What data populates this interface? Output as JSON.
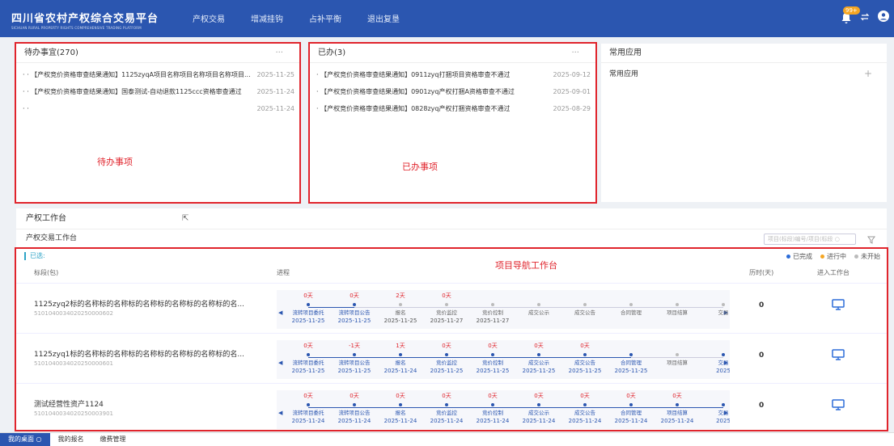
{
  "header": {
    "title": "四川省农村产权综合交易平台",
    "subtitle": "SICHUAN RURAL PROPERTY RIGHTS COMPREHENSIVE TRADING PLATFORM",
    "nav": [
      "产权交易",
      "增减挂钩",
      "占补平衡",
      "退出复垦"
    ],
    "badge": "99+"
  },
  "todo": {
    "title": "待办事宜(270)",
    "more": "···",
    "items": [
      {
        "text": "· · 【产权竞价资格审查结果通知】1125zyqA项目名称项目名称项目名称项目...",
        "date": "2025-11-25"
      },
      {
        "text": "· · 【产权竞价资格审查结果通知】国泰测试-自动退款1125ccc资格审查通过",
        "date": "2025-11-24"
      },
      {
        "text": "· ·",
        "date": "2025-11-24"
      }
    ],
    "annotation": "待办事项"
  },
  "done": {
    "title": "已办(3)",
    "more": "···",
    "items": [
      {
        "text": "· 【产权竞价资格审查结果通知】0911zyq打捆项目资格审查不通过",
        "date": "2025-09-12"
      },
      {
        "text": "· 【产权竞价资格审查结果通知】0901zyq产权打捆A资格审查不通过",
        "date": "2025-09-01"
      },
      {
        "text": "· 【产权竞价资格审查结果通知】0828zyq产权打捆资格审查不通过",
        "date": "2025-08-29"
      }
    ],
    "annotation": "已办事项"
  },
  "common": {
    "title": "常用应用",
    "subtitle": "常用应用",
    "plus": "+"
  },
  "workbench": {
    "title": "产权工作台",
    "subtitle": "产权交易工作台",
    "search_placeholder": "项目(标段)编号/项目(标段 ○",
    "selected": "已选:",
    "annotation": "项目导航工作台",
    "legend": [
      {
        "label": "已完成",
        "color": "#2b6cd8"
      },
      {
        "label": "进行中",
        "color": "#f5a623"
      },
      {
        "label": "未开始",
        "color": "#bbbbbb"
      }
    ],
    "columns": {
      "name": "标段(包)",
      "progress": "进程",
      "duration": "历时(天)",
      "enter": "进入工作台"
    },
    "rows": [
      {
        "name": "1125zyq2标的名称标的名称标的名称标的名称标的名称标的名...",
        "code": "5101040034020250000602",
        "duration": "0",
        "stages": [
          {
            "name": "流转项目委托",
            "days": "0天",
            "date": "2025-11-25",
            "done": true
          },
          {
            "name": "流转项目公告",
            "days": "0天",
            "date": "2025-11-25",
            "done": true
          },
          {
            "name": "报名",
            "days": "2天",
            "date": "2025-11-25",
            "done": false
          },
          {
            "name": "竞价监控",
            "days": "0天",
            "date": "2025-11-27",
            "done": false
          },
          {
            "name": "竞价控制",
            "days": "",
            "date": "2025-11-27",
            "done": false
          },
          {
            "name": "成交公示",
            "days": "",
            "date": "",
            "done": false
          },
          {
            "name": "成交公告",
            "days": "",
            "date": "",
            "done": false
          },
          {
            "name": "合同管理",
            "days": "",
            "date": "",
            "done": false
          },
          {
            "name": "项目结算",
            "days": "",
            "date": "",
            "done": false
          },
          {
            "name": "交易",
            "days": "",
            "date": "",
            "done": false
          }
        ]
      },
      {
        "name": "1125zyq1标的名称标的名称标的名称标的名称标的名称标的名...",
        "code": "5101040034020250000601",
        "duration": "0",
        "stages": [
          {
            "name": "流转项目委托",
            "days": "0天",
            "date": "2025-11-25",
            "done": true
          },
          {
            "name": "流转项目公告",
            "days": "-1天",
            "date": "2025-11-25",
            "done": true
          },
          {
            "name": "报名",
            "days": "1天",
            "date": "2025-11-24",
            "done": true
          },
          {
            "name": "竞价监控",
            "days": "0天",
            "date": "2025-11-25",
            "done": true
          },
          {
            "name": "竞价控制",
            "days": "0天",
            "date": "2025-11-25",
            "done": true
          },
          {
            "name": "成交公示",
            "days": "0天",
            "date": "2025-11-25",
            "done": true
          },
          {
            "name": "成交公告",
            "days": "0天",
            "date": "2025-11-25",
            "done": true
          },
          {
            "name": "合同管理",
            "days": "",
            "date": "2025-11-25",
            "done": true
          },
          {
            "name": "项目结算",
            "days": "",
            "date": "",
            "done": false
          },
          {
            "name": "交易",
            "days": "",
            "date": "2025",
            "done": true
          }
        ]
      },
      {
        "name": "测试经营性资产1124",
        "code": "5101040034020250003901",
        "duration": "0",
        "stages": [
          {
            "name": "流转项目委托",
            "days": "0天",
            "date": "2025-11-24",
            "done": true
          },
          {
            "name": "流转项目公告",
            "days": "0天",
            "date": "2025-11-24",
            "done": true
          },
          {
            "name": "报名",
            "days": "0天",
            "date": "2025-11-24",
            "done": true
          },
          {
            "name": "竞价监控",
            "days": "0天",
            "date": "2025-11-24",
            "done": true
          },
          {
            "name": "竞价控制",
            "days": "0天",
            "date": "2025-11-24",
            "done": true
          },
          {
            "name": "成交公示",
            "days": "0天",
            "date": "2025-11-24",
            "done": true
          },
          {
            "name": "成交公告",
            "days": "0天",
            "date": "2025-11-24",
            "done": true
          },
          {
            "name": "合同管理",
            "days": "0天",
            "date": "2025-11-24",
            "done": true
          },
          {
            "name": "项目结算",
            "days": "0天",
            "date": "2025-11-24",
            "done": true
          },
          {
            "name": "交易",
            "days": "",
            "date": "2025",
            "done": true
          }
        ]
      }
    ]
  },
  "bottom_tabs": [
    "我的桌面 ○",
    "我的报名",
    "缴费管理"
  ]
}
